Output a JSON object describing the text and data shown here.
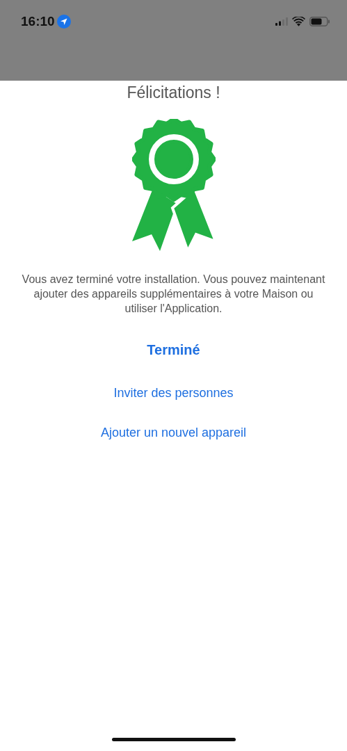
{
  "status_bar": {
    "time": "16:10",
    "location_active": true
  },
  "title": "Félicitations !",
  "message": "Vous avez terminé votre installation. Vous pouvez maintenant ajouter des appareils supplémentaires à votre Maison ou utiliser l'Application.",
  "actions": [
    {
      "label": "Terminé",
      "kind": "primary"
    },
    {
      "label": "Inviter des personnes",
      "kind": "secondary"
    },
    {
      "label": "Ajouter un nouvel appareil",
      "kind": "secondary"
    }
  ]
}
